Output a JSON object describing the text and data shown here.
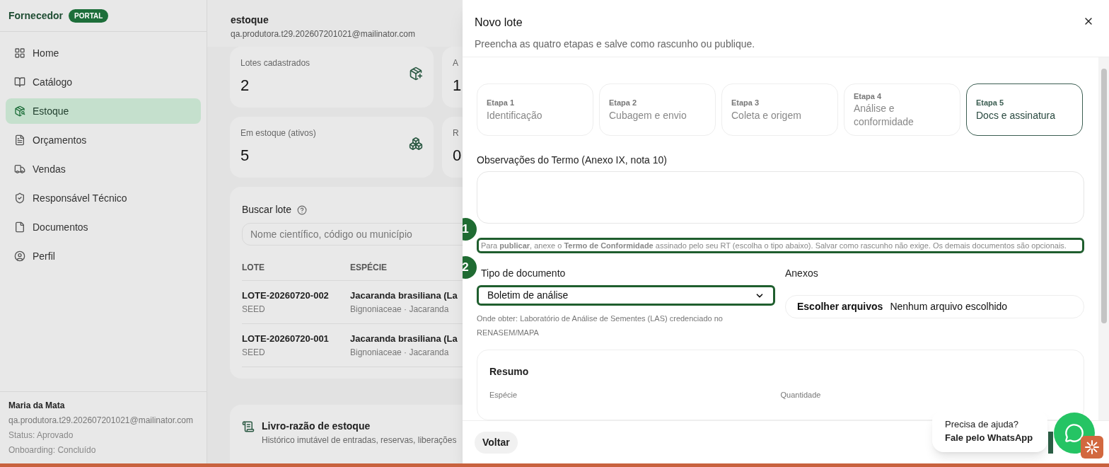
{
  "brand": {
    "name": "Fornecedor",
    "badge": "PORTAL"
  },
  "sidebar": {
    "items": [
      {
        "label": "Home",
        "selected": false
      },
      {
        "label": "Catálogo",
        "selected": false
      },
      {
        "label": "Estoque",
        "selected": true
      },
      {
        "label": "Orçamentos",
        "selected": false
      },
      {
        "label": "Vendas",
        "selected": false
      },
      {
        "label": "Responsável Técnico",
        "selected": false
      },
      {
        "label": "Documentos",
        "selected": false
      },
      {
        "label": "Perfil",
        "selected": false
      }
    ],
    "user": {
      "name": "Maria da Mata",
      "email": "qa.produtora.t29.202607201021@mailinator.com",
      "status": "Status: Aprovado",
      "onboarding": "Onboarding: Concluído"
    }
  },
  "header": {
    "title": "estoque",
    "email": "qa.produtora.t29.202607201021@mailinator.com"
  },
  "stats": [
    {
      "label": "Lotes cadastrados",
      "value": "2"
    },
    {
      "label": "A",
      "value": "1"
    },
    {
      "label": "Em estoque (ativos)",
      "value": "5"
    },
    {
      "label": "R",
      "value": "0"
    }
  ],
  "search": {
    "label": "Buscar lote",
    "placeholder": "Nome científico, código ou município"
  },
  "table": {
    "columns": [
      "LOTE",
      "ESPÉCIE"
    ],
    "rows": [
      {
        "lote": "LOTE-20260720-002",
        "type": "SEED",
        "species": "Jacaranda brasiliana (La",
        "family": "Bignoniaceae · Jacaranda"
      },
      {
        "lote": "LOTE-20260720-001",
        "type": "SEED",
        "species": "Jacaranda brasiliana (La",
        "family": "Bignoniaceae · Jacaranda"
      }
    ]
  },
  "ledger": {
    "title": "Livro-razão de estoque",
    "subtitle": "Histórico imutável de entradas, reservas, liberações"
  },
  "modal": {
    "title": "Novo lote",
    "subtitle": "Preencha as quatro etapas e salve como rascunho ou publique.",
    "steps": [
      {
        "step": "Etapa 1",
        "label": "Identificação",
        "selected": false
      },
      {
        "step": "Etapa 2",
        "label": "Cubagem e envio",
        "selected": false
      },
      {
        "step": "Etapa 3",
        "label": "Coleta e origem",
        "selected": false
      },
      {
        "step": "Etapa 4",
        "label": "Análise e conformidade",
        "selected": false
      },
      {
        "step": "Etapa 5",
        "label": "Docs e assinatura",
        "selected": true
      }
    ],
    "notes_label": "Observações do Termo (Anexo IX, nota 10)",
    "notice": "Para **publicar**, anexe o **Termo de Conformidade** assinado pelo seu RT (escolha o tipo abaixo). Salvar como rascunho não exige. Os demais documentos são opcionais.",
    "doc_type": {
      "label": "Tipo de documento",
      "value": "Boletim de análise",
      "hint": "Onde obter: Laboratório de Análise de Sementes (LAS) credenciado no RENASEM/MAPA"
    },
    "attachments": {
      "label": "Anexos",
      "button": "Escolher arquivos",
      "status": "Nenhum arquivo escolhido"
    },
    "summary": {
      "title": "Resumo",
      "fields": [
        "Espécie",
        "Quantidade"
      ]
    },
    "back": "Voltar"
  },
  "annotations": [
    {
      "label": "1"
    },
    {
      "label": "2"
    }
  ],
  "help": {
    "line1": "Precisa de ajuda?",
    "line2": "Fale pelo WhatsApp"
  }
}
